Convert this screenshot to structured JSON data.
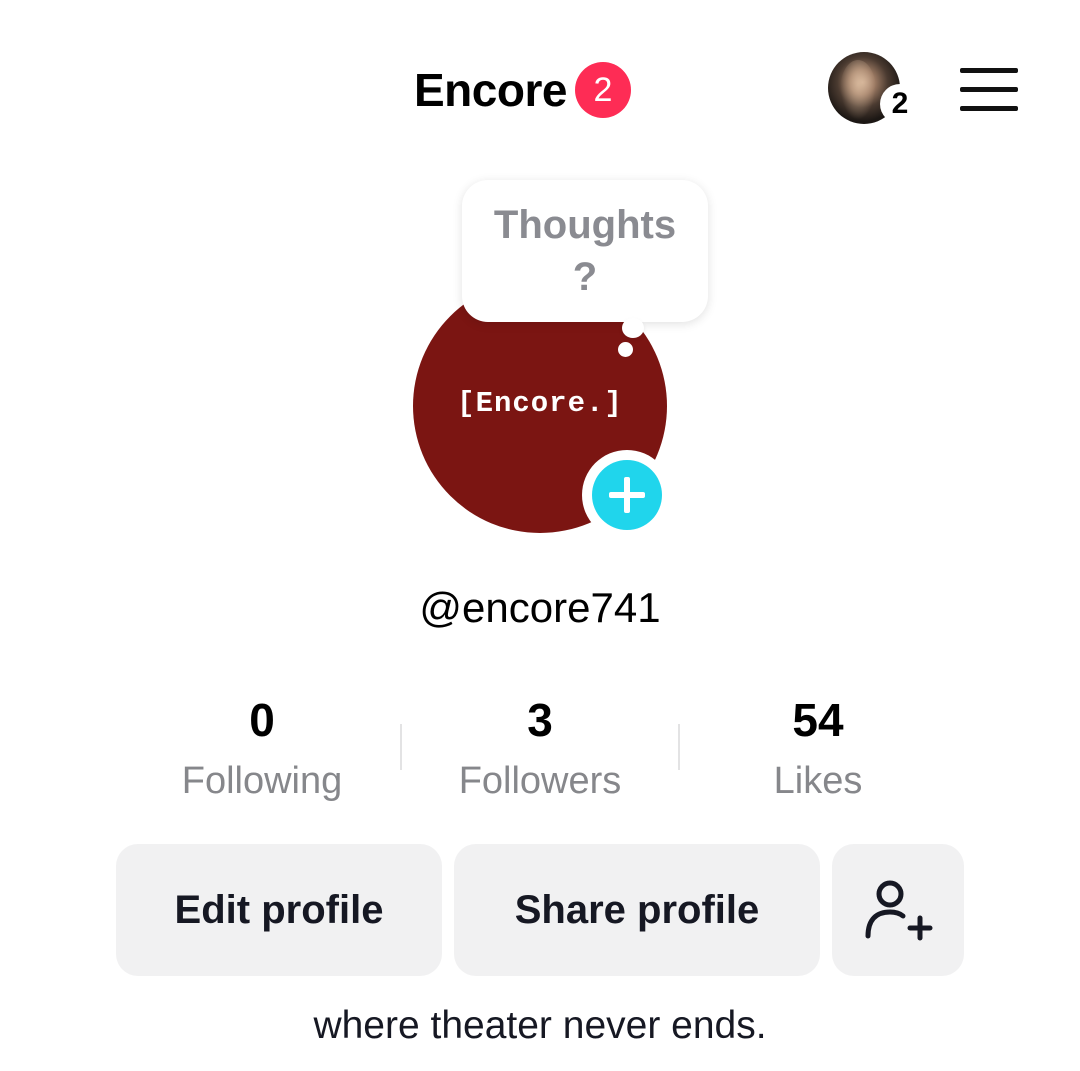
{
  "header": {
    "title": "Encore",
    "notification_count": "2",
    "account_count": "2",
    "menu_icon": "hamburger-menu-icon"
  },
  "profile": {
    "avatar_text": "[Encore.]",
    "avatar_color": "#7b1512",
    "add_icon": "plus-icon",
    "bubble_text": "Thoughts ?",
    "username": "@encore741"
  },
  "stats": [
    {
      "value": "0",
      "label": "Following"
    },
    {
      "value": "3",
      "label": "Followers"
    },
    {
      "value": "54",
      "label": "Likes"
    }
  ],
  "actions": {
    "edit_label": "Edit profile",
    "share_label": "Share profile",
    "add_friend_icon": "add-friend-icon"
  },
  "bio": "where theater never ends.",
  "colors": {
    "badge": "#fe2c55",
    "accent": "#20d5ec",
    "button_bg": "#f1f1f2",
    "muted_text": "#86878b"
  }
}
